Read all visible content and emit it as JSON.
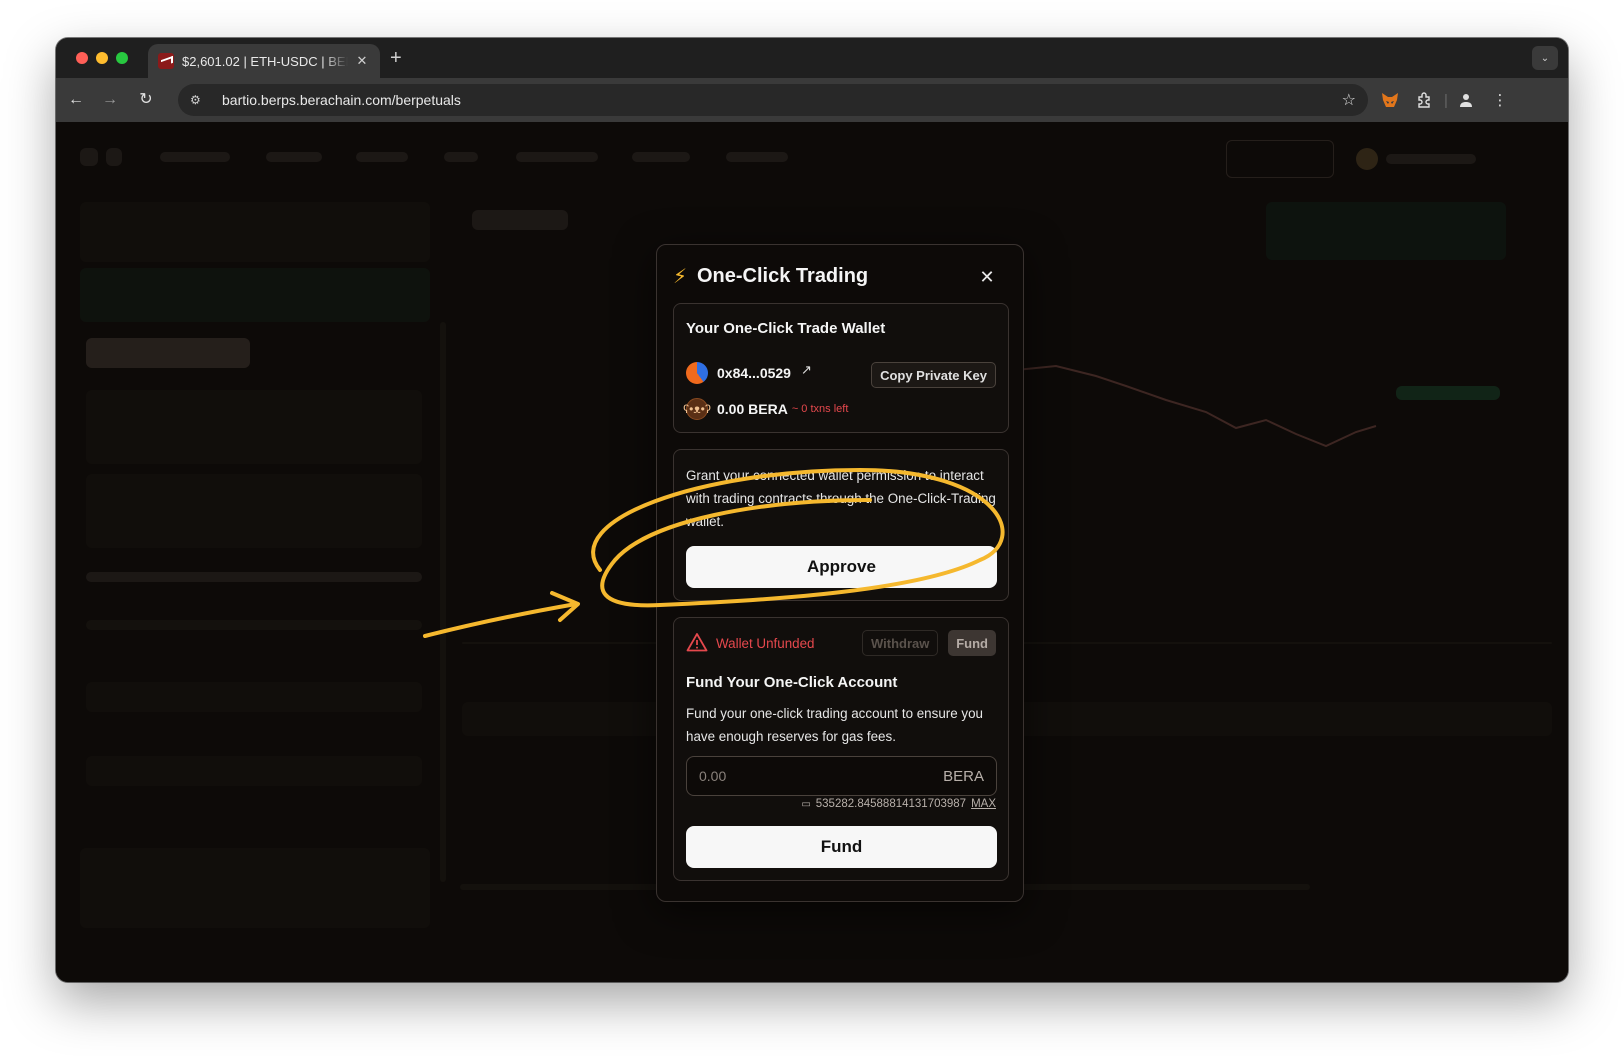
{
  "browser": {
    "tab_title": "$2,601.02 | ETH-USDC | BERPS",
    "tab_close": "✕",
    "new_tab": "+",
    "url": "bartio.berps.berachain.com/berpetuals"
  },
  "modal": {
    "title": "One-Click Trading",
    "close": "✕",
    "wallet_card": {
      "title": "Your One-Click Trade Wallet",
      "address": "0x84...0529",
      "copy_label": "Copy Private Key",
      "balance": "0.00 BERA",
      "txns_left": "~ 0 txns left"
    },
    "approve_card": {
      "description": "Grant your connected wallet permission to interact with trading contracts through the One-Click-Trading wallet.",
      "approve_label": "Approve"
    },
    "fund_card": {
      "status": "Wallet Unfunded",
      "withdraw_label": "Withdraw",
      "fund_tab_label": "Fund",
      "title": "Fund Your One-Click Account",
      "description": "Fund your one-click trading account to ensure you have enough reserves for gas fees.",
      "amount_placeholder": "0.00",
      "unit": "BERA",
      "available": "535282.84588814131703987",
      "max_label": "MAX",
      "fund_label": "Fund"
    }
  },
  "colors": {
    "accent": "#f5b82e",
    "danger": "#e5484d",
    "annotation": "#f5b82e"
  }
}
